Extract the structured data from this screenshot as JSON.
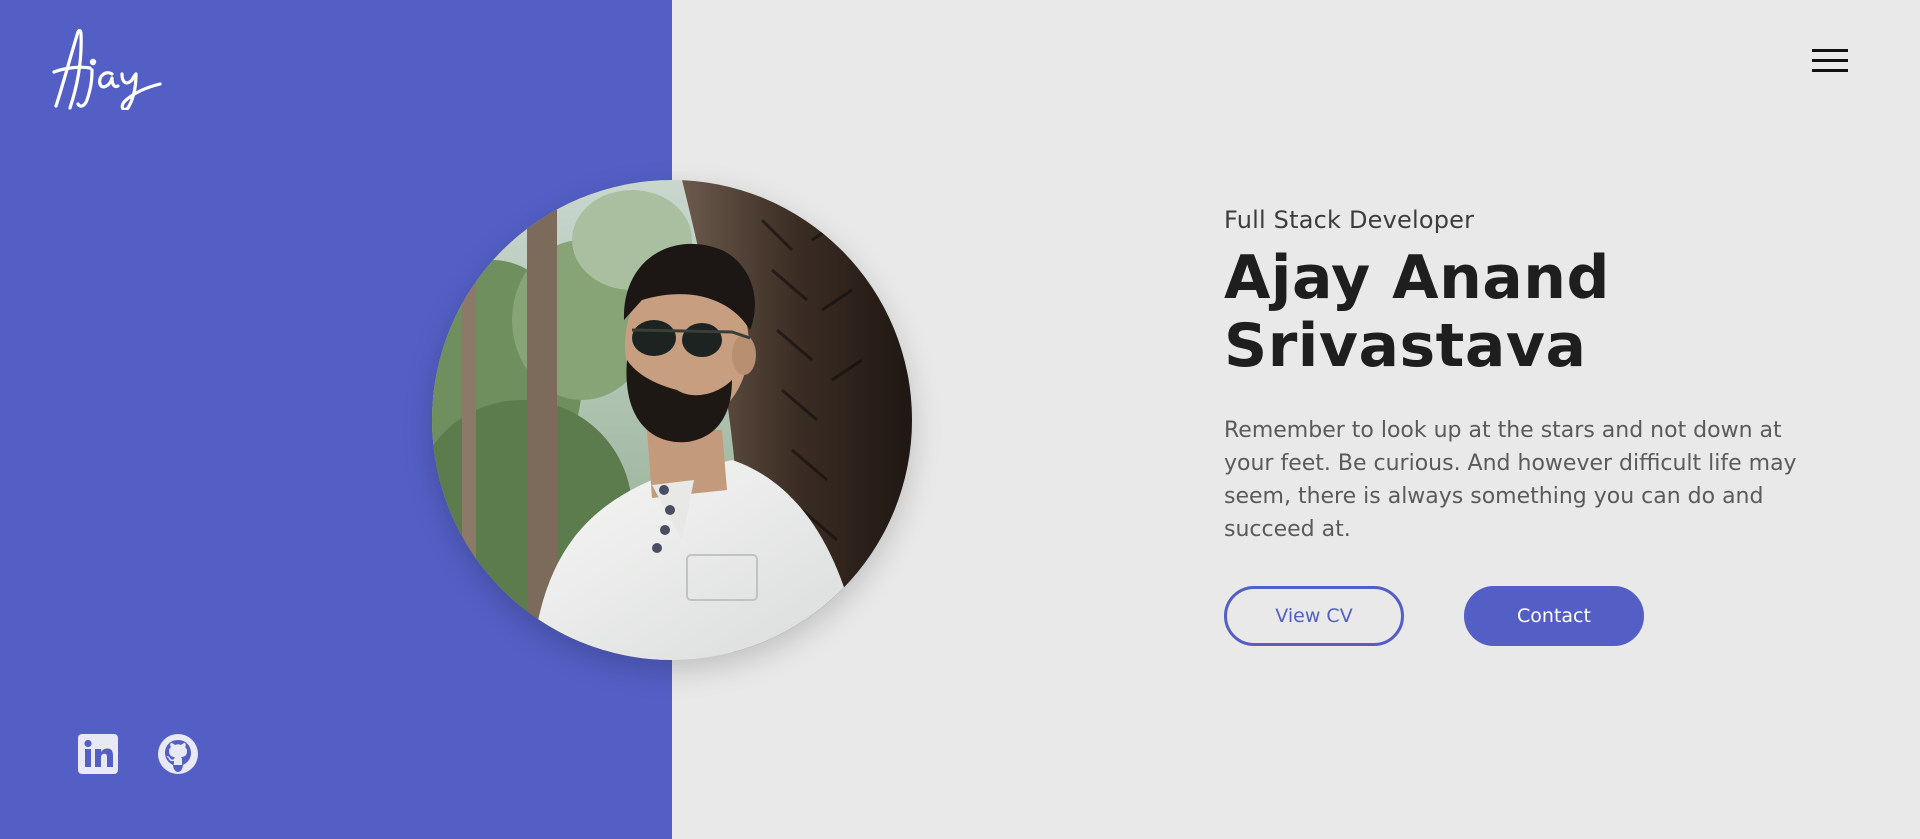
{
  "brand": {
    "logo_text": "Ajay"
  },
  "hero": {
    "role": "Full Stack Developer",
    "name_line1": "Ajay Anand",
    "name_line2": "Srivastava",
    "quote": "Remember to look up at the stars and not down at your feet. Be curious. And however difficult life may seem, there is always something you can do and succeed at.",
    "view_cv_label": "View CV",
    "contact_label": "Contact"
  },
  "socials": [
    {
      "icon": "linkedin-icon"
    },
    {
      "icon": "github-icon"
    }
  ],
  "colors": {
    "accent": "#535fc5",
    "background": "#e9e9e9",
    "heading": "#1e1e1e",
    "body_text": "#5a5a5a"
  }
}
